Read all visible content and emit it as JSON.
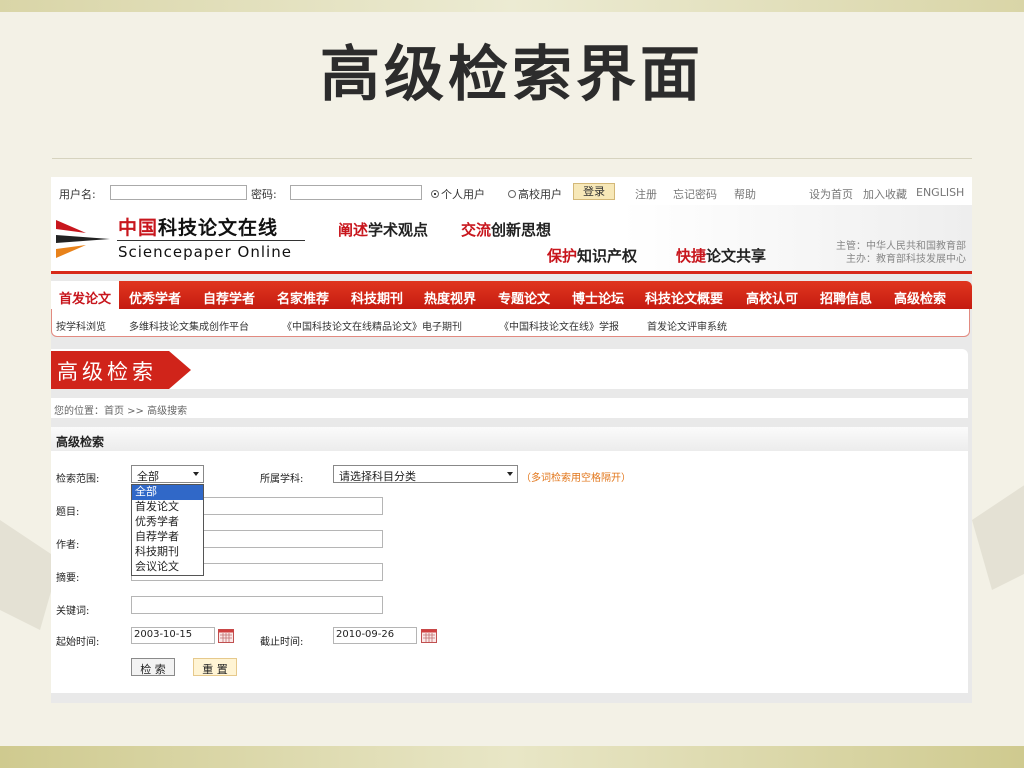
{
  "slide": {
    "title": "高级检索界面"
  },
  "loginbar": {
    "username_label": "用户名:",
    "password_label": "密码:",
    "radio_personal": "个人用户",
    "radio_school": "高校用户",
    "login_button": "登录",
    "register": "注册",
    "forgot_password": "忘记密码",
    "help": "帮助",
    "set_homepage": "设为首页",
    "add_favorite": "加入收藏",
    "english": "ENGLISH"
  },
  "header": {
    "logo_cn_red": "中国",
    "logo_cn_black": "科技论文在线",
    "logo_en": "Sciencepaper Online",
    "slogan1_red": "阐述",
    "slogan1_black": "学术观点",
    "slogan2_red": "交流",
    "slogan2_black": "创新思想",
    "slogan3_red": "保护",
    "slogan3_black": "知识产权",
    "slogan4_red": "快捷",
    "slogan4_black": "论文共享",
    "sponsor1": "主管：中华人民共和国教育部",
    "sponsor2": "主办：教育部科技发展中心"
  },
  "nav": {
    "items": [
      "首发论文",
      "优秀学者",
      "自荐学者",
      "名家推荐",
      "科技期刊",
      "热度视界",
      "专题论文",
      "博士论坛",
      "科技论文概要",
      "高校认可",
      "招聘信息",
      "高级检索"
    ],
    "active_index": 0
  },
  "subnav": [
    "按学科浏览",
    "多维科技论文集成创作平台",
    "《中国科技论文在线精品论文》电子期刊",
    "《中国科技论文在线》学报",
    "首发论文评审系统"
  ],
  "banner": {
    "title": "高级检索"
  },
  "breadcrumb": {
    "text": "您的位置：首页 >> 高级搜索"
  },
  "form": {
    "heading": "高级检索",
    "scope_label": "检索范围:",
    "scope_value": "全部",
    "scope_options": [
      "全部",
      "首发论文",
      "优秀学者",
      "自荐学者",
      "科技期刊",
      "会议论文"
    ],
    "subject_label": "所属学科:",
    "subject_value": "请选择科目分类",
    "hint": "（多词检索用空格隔开）",
    "title_label": "题目:",
    "author_label": "作者:",
    "abstract_label": "摘要:",
    "keyword_label": "关键词:",
    "start_label": "起始时间:",
    "start_value": "2003-10-15",
    "end_label": "截止时间:",
    "end_value": "2010-09-26",
    "search_button": "检 索",
    "reset_button": "重 置"
  },
  "colors": {
    "brand_red": "#c8161d",
    "nav_red": "#d0241a",
    "hint_orange": "#e2761a",
    "highlight_blue": "#3068c8"
  }
}
